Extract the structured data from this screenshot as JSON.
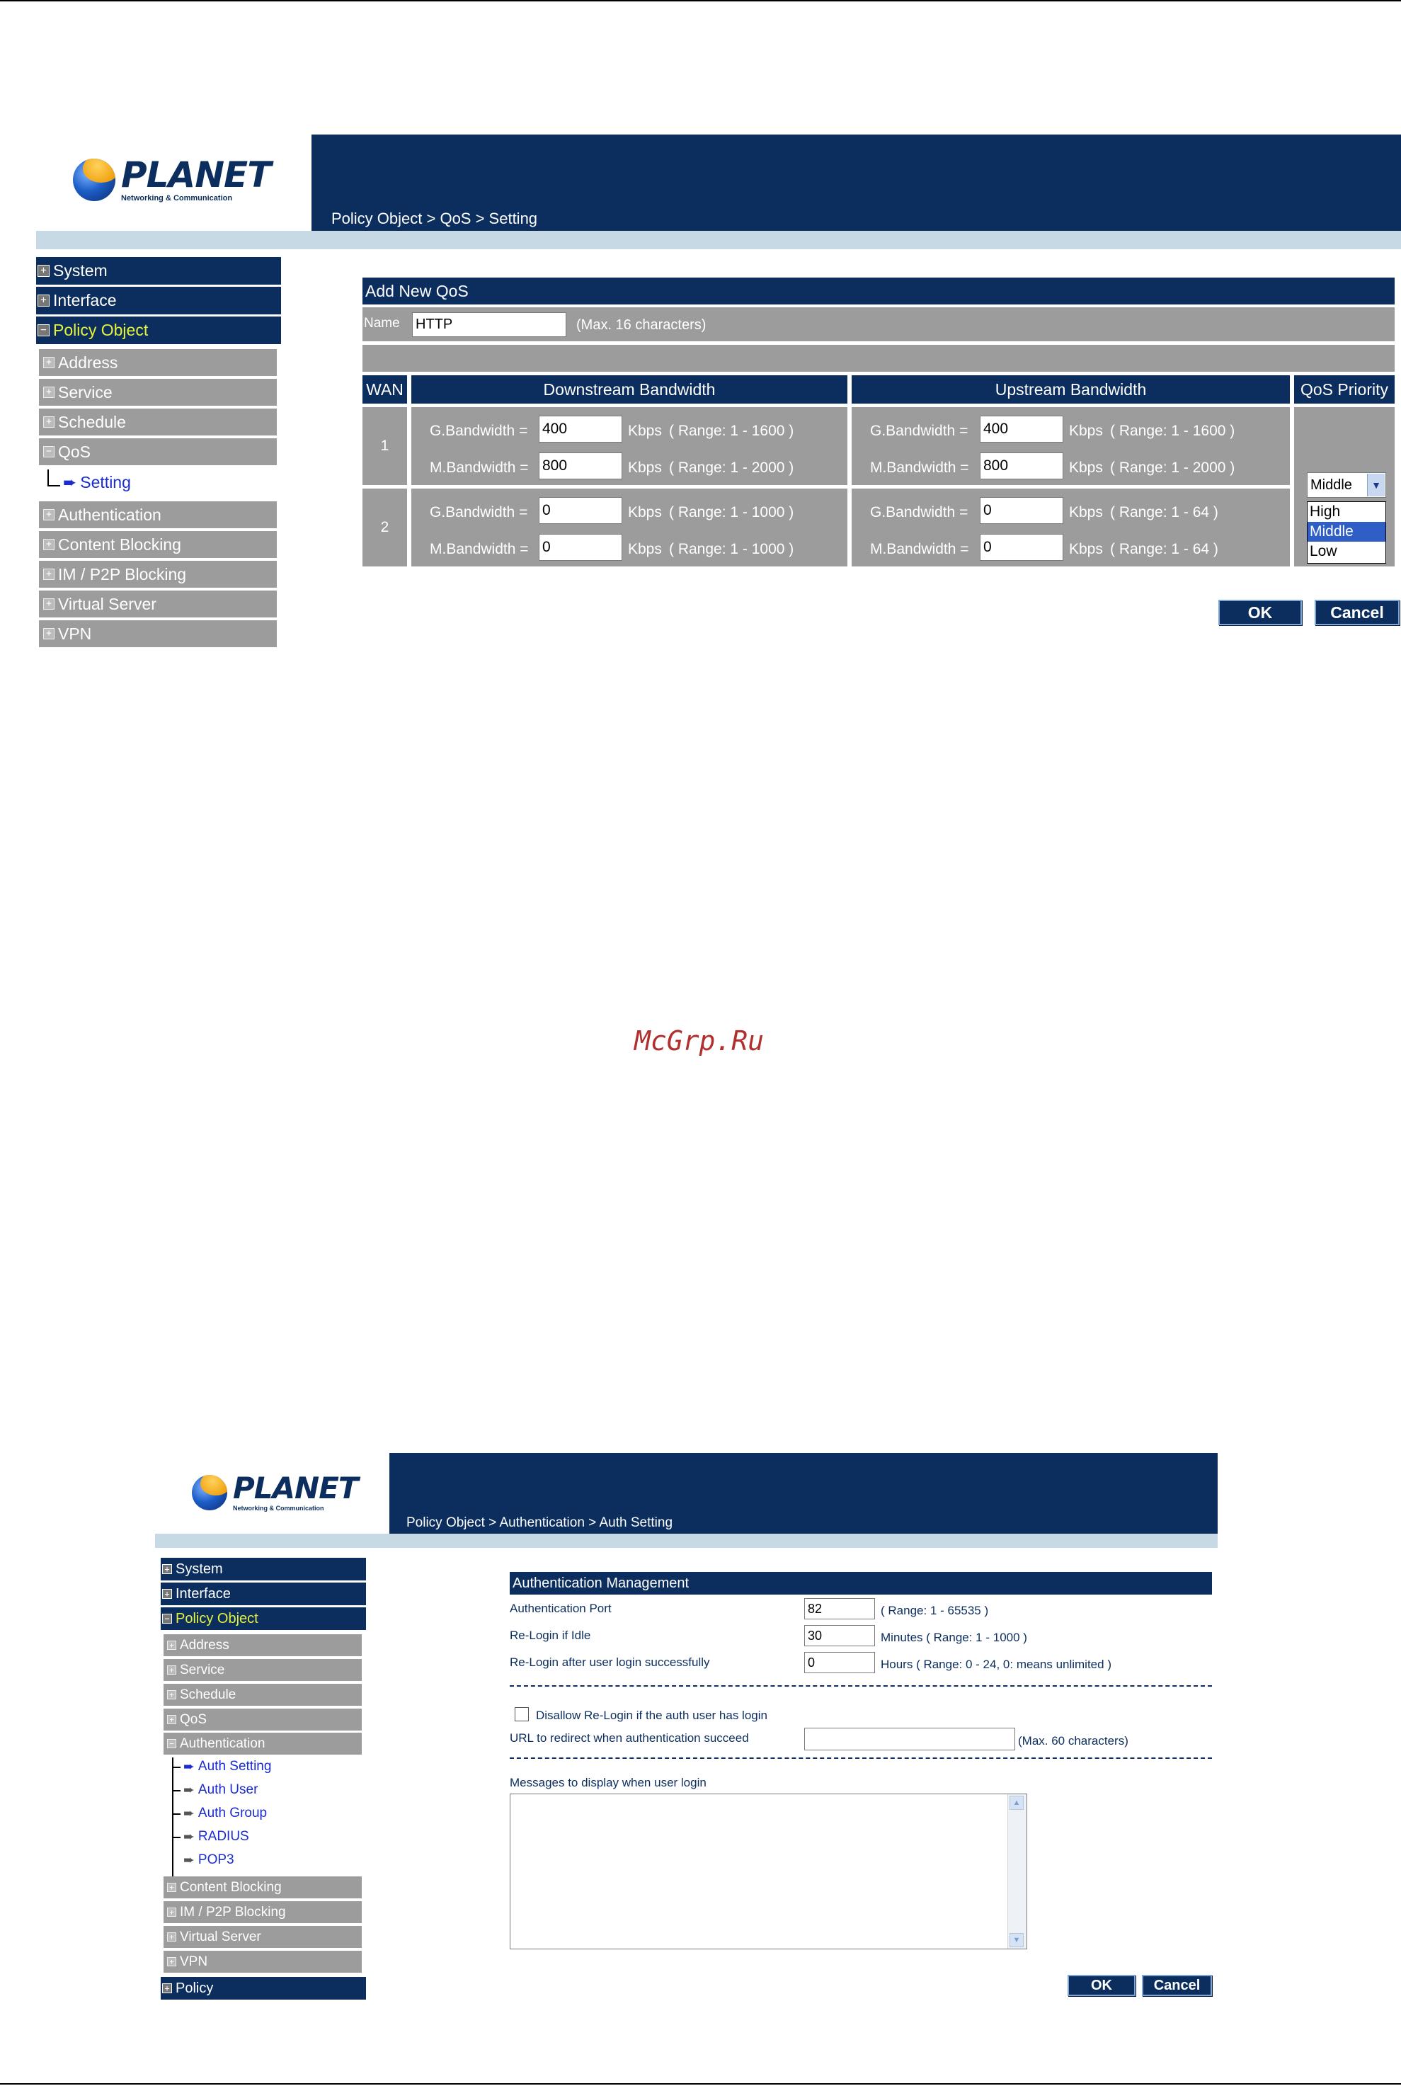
{
  "watermark": "McGrp.Ru",
  "logo": {
    "word": "PLANET",
    "tagline": "Networking & Communication"
  },
  "s1": {
    "breadcrumb": "Policy Object > QoS > Setting",
    "nav": {
      "system": "System",
      "interface": "Interface",
      "policy_object": "Policy Object",
      "address": "Address",
      "service": "Service",
      "schedule": "Schedule",
      "qos": "QoS",
      "setting": "Setting",
      "authentication": "Authentication",
      "content_blocking": "Content Blocking",
      "im_p2p": "IM / P2P Blocking",
      "virtual_server": "Virtual Server",
      "vpn": "VPN"
    },
    "form": {
      "header": "Add New QoS",
      "name_label": "Name",
      "name_value": "HTTP",
      "name_hint": "(Max. 16 characters)",
      "col_wan": "WAN",
      "col_down": "Downstream Bandwidth",
      "col_up": "Upstream Bandwidth",
      "col_priority": "QoS Priority",
      "g_label": "G.Bandwidth =",
      "m_label": "M.Bandwidth =",
      "kbps": "Kbps",
      "rows": [
        {
          "wan": "1",
          "down_g": "400",
          "down_g_range": "( Range: 1 - 1600 )",
          "down_m": "800",
          "down_m_range": "( Range: 1 - 2000 )",
          "up_g": "400",
          "up_g_range": "( Range: 1 - 1600 )",
          "up_m": "800",
          "up_m_range": "( Range: 1 - 2000 )"
        },
        {
          "wan": "2",
          "down_g": "0",
          "down_g_range": "( Range: 1 - 1000 )",
          "down_m": "0",
          "down_m_range": "( Range: 1 - 1000 )",
          "up_g": "0",
          "up_g_range": "( Range: 1 - 64 )",
          "up_m": "0",
          "up_m_range": "( Range: 1 - 64 )"
        }
      ],
      "priority_selected": "Middle",
      "priority_options": [
        "High",
        "Middle",
        "Low"
      ],
      "ok": "OK",
      "cancel": "Cancel"
    }
  },
  "s2": {
    "breadcrumb": "Policy Object > Authentication > Auth Setting",
    "nav": {
      "system": "System",
      "interface": "Interface",
      "policy_object": "Policy Object",
      "address": "Address",
      "service": "Service",
      "schedule": "Schedule",
      "qos": "QoS",
      "authentication": "Authentication",
      "auth_setting": "Auth Setting",
      "auth_user": "Auth User",
      "auth_group": "Auth Group",
      "radius": "RADIUS",
      "pop3": "POP3",
      "content_blocking": "Content Blocking",
      "im_p2p": "IM / P2P Blocking",
      "virtual_server": "Virtual Server",
      "vpn": "VPN",
      "policy": "Policy"
    },
    "form": {
      "header": "Authentication Management",
      "port_label": "Authentication Port",
      "port_value": "82",
      "port_hint": "( Range: 1 - 65535 )",
      "idle_label": "Re-Login if Idle",
      "idle_value": "30",
      "idle_hint": "Minutes  ( Range: 1 - 1000 )",
      "after_label": "Re-Login after user login successfully",
      "after_value": "0",
      "after_hint": "Hours  ( Range: 0 - 24, 0: means unlimited )",
      "disallow_label": "Disallow Re-Login if the auth user has login",
      "url_label": "URL to redirect when authentication succeed",
      "url_value": "",
      "url_hint": "(Max. 60 characters)",
      "msg_label": "Messages to display when user login",
      "ok": "OK",
      "cancel": "Cancel"
    }
  }
}
